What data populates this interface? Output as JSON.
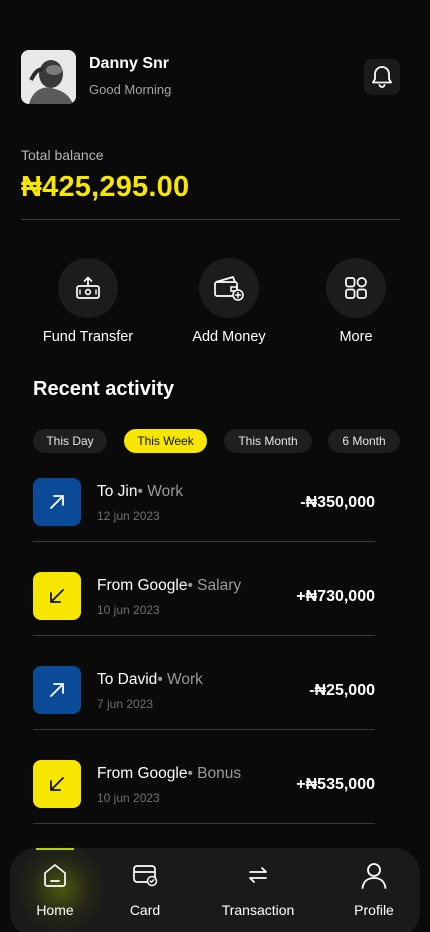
{
  "header": {
    "user_name": "Danny Snr",
    "greeting": "Good Morning"
  },
  "balance": {
    "label": "Total balance",
    "amount": "₦425,295.00",
    "accent_color": "#f7e600"
  },
  "actions": [
    {
      "label": "Fund Transfer",
      "icon": "fund-transfer-icon"
    },
    {
      "label": "Add Money",
      "icon": "add-money-icon"
    },
    {
      "label": "More",
      "icon": "grid-icon"
    }
  ],
  "recent": {
    "title": "Recent activity",
    "filters": [
      "This Day",
      "This Week",
      "This Month",
      "6 Month"
    ],
    "active_filter": "This Week",
    "items": [
      {
        "title": "To Jin",
        "category": "• Work",
        "date": "12 jun 2023",
        "amount": "-₦350,000",
        "direction": "out"
      },
      {
        "title": "From Google",
        "category": "• Salary",
        "date": "10 jun 2023",
        "amount": "+₦730,000",
        "direction": "in"
      },
      {
        "title": "To David",
        "category": "• Work",
        "date": "7 jun 2023",
        "amount": "-₦25,000",
        "direction": "out"
      },
      {
        "title": "From Google",
        "category": "• Bonus",
        "date": "10 jun 2023",
        "amount": "+₦535,000",
        "direction": "in"
      }
    ]
  },
  "nav": {
    "items": [
      {
        "label": "Home",
        "icon": "home-icon",
        "active": true
      },
      {
        "label": "Card",
        "icon": "card-icon"
      },
      {
        "label": "Transaction",
        "icon": "transfer-arrows-icon"
      },
      {
        "label": "Profile",
        "icon": "user-icon"
      }
    ]
  },
  "colors": {
    "outgoing": "#0a4a96",
    "incoming": "#f7e600",
    "background": "#0a0a0a"
  }
}
